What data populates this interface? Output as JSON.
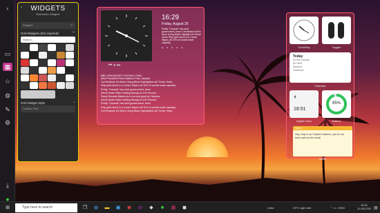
{
  "sidebar_rail": {
    "icons": [
      "chevron-left-icon",
      "monitor-icon",
      "widgets-icon",
      "star-icon",
      "settings-icon",
      "tools-icon",
      "gear-icon",
      "download-icon",
      "check-icon"
    ]
  },
  "panel": {
    "title": "WIDGETS",
    "subtitle": "Rainmeter Widgets",
    "filter_value": "Widgets",
    "section1": "Grid Widgets (iOS inspired)",
    "search_placeholder": "Search...",
    "section2": "Grid Widget Style",
    "style_value": "Custom Text"
  },
  "widget1": {
    "time": "16:29",
    "date": "Friday, August 25",
    "quote": "Pretty \"Canada\" has sent government, been Crit Medium fort's been Using Black Highlight All These Years Ship gets stuck at a Canal: Wipes off 10% of worlds trade capacity",
    "dots": "• • • • •",
    "controls": "⏮  ⏸  ⏭",
    "news_header": "BBC ENGADGET KOTAKU CNN",
    "news": [
      "New President Feels Nation's Pain, Despite",
      "Cat Realizes It's Been Using Black Highlighters All These Years",
      "Ship gets stuck in a Canal: Wipes off 10% of worlds trade capacity",
      "Pretty \"Canada\" has sent government, been",
      "World Death Rate Holding Steady at 100 Percent",
      "Study Reveals Babies Are not very good at Calculus",
      "World Death Rate Holding Steady at 100 Percent",
      "Pretty \"Canada\" has sent government, been",
      "Ship gets stuck in a Canal: Wipes off 10% of worlds trade capacity",
      "Cat Realizes It's Been Using Black Highlighters All These Years"
    ]
  },
  "widget2": {
    "clock_label": "ClockDay",
    "toggle_label": "Toggler",
    "calendar_title": "Today",
    "calendar_items": [
      "Do the Laundry",
      "AZ 0000",
      "Workout",
      "Tomorrow"
    ],
    "calendar_label": "Calendar",
    "weather_temp": "18:51",
    "weather_label": "Digital Clock",
    "battery_pct": "95%",
    "battery_label": "Battery",
    "note_bar": "Notes",
    "note_text": "Hey, wrap it up Charles Dickens, you've not been paid by the word!",
    "note_label": "Notes"
  },
  "taskbar": {
    "search": "Type here to search",
    "weather": "29°C  Light rain",
    "time": "16:01",
    "date": "11-08-2022",
    "links": "Links"
  }
}
